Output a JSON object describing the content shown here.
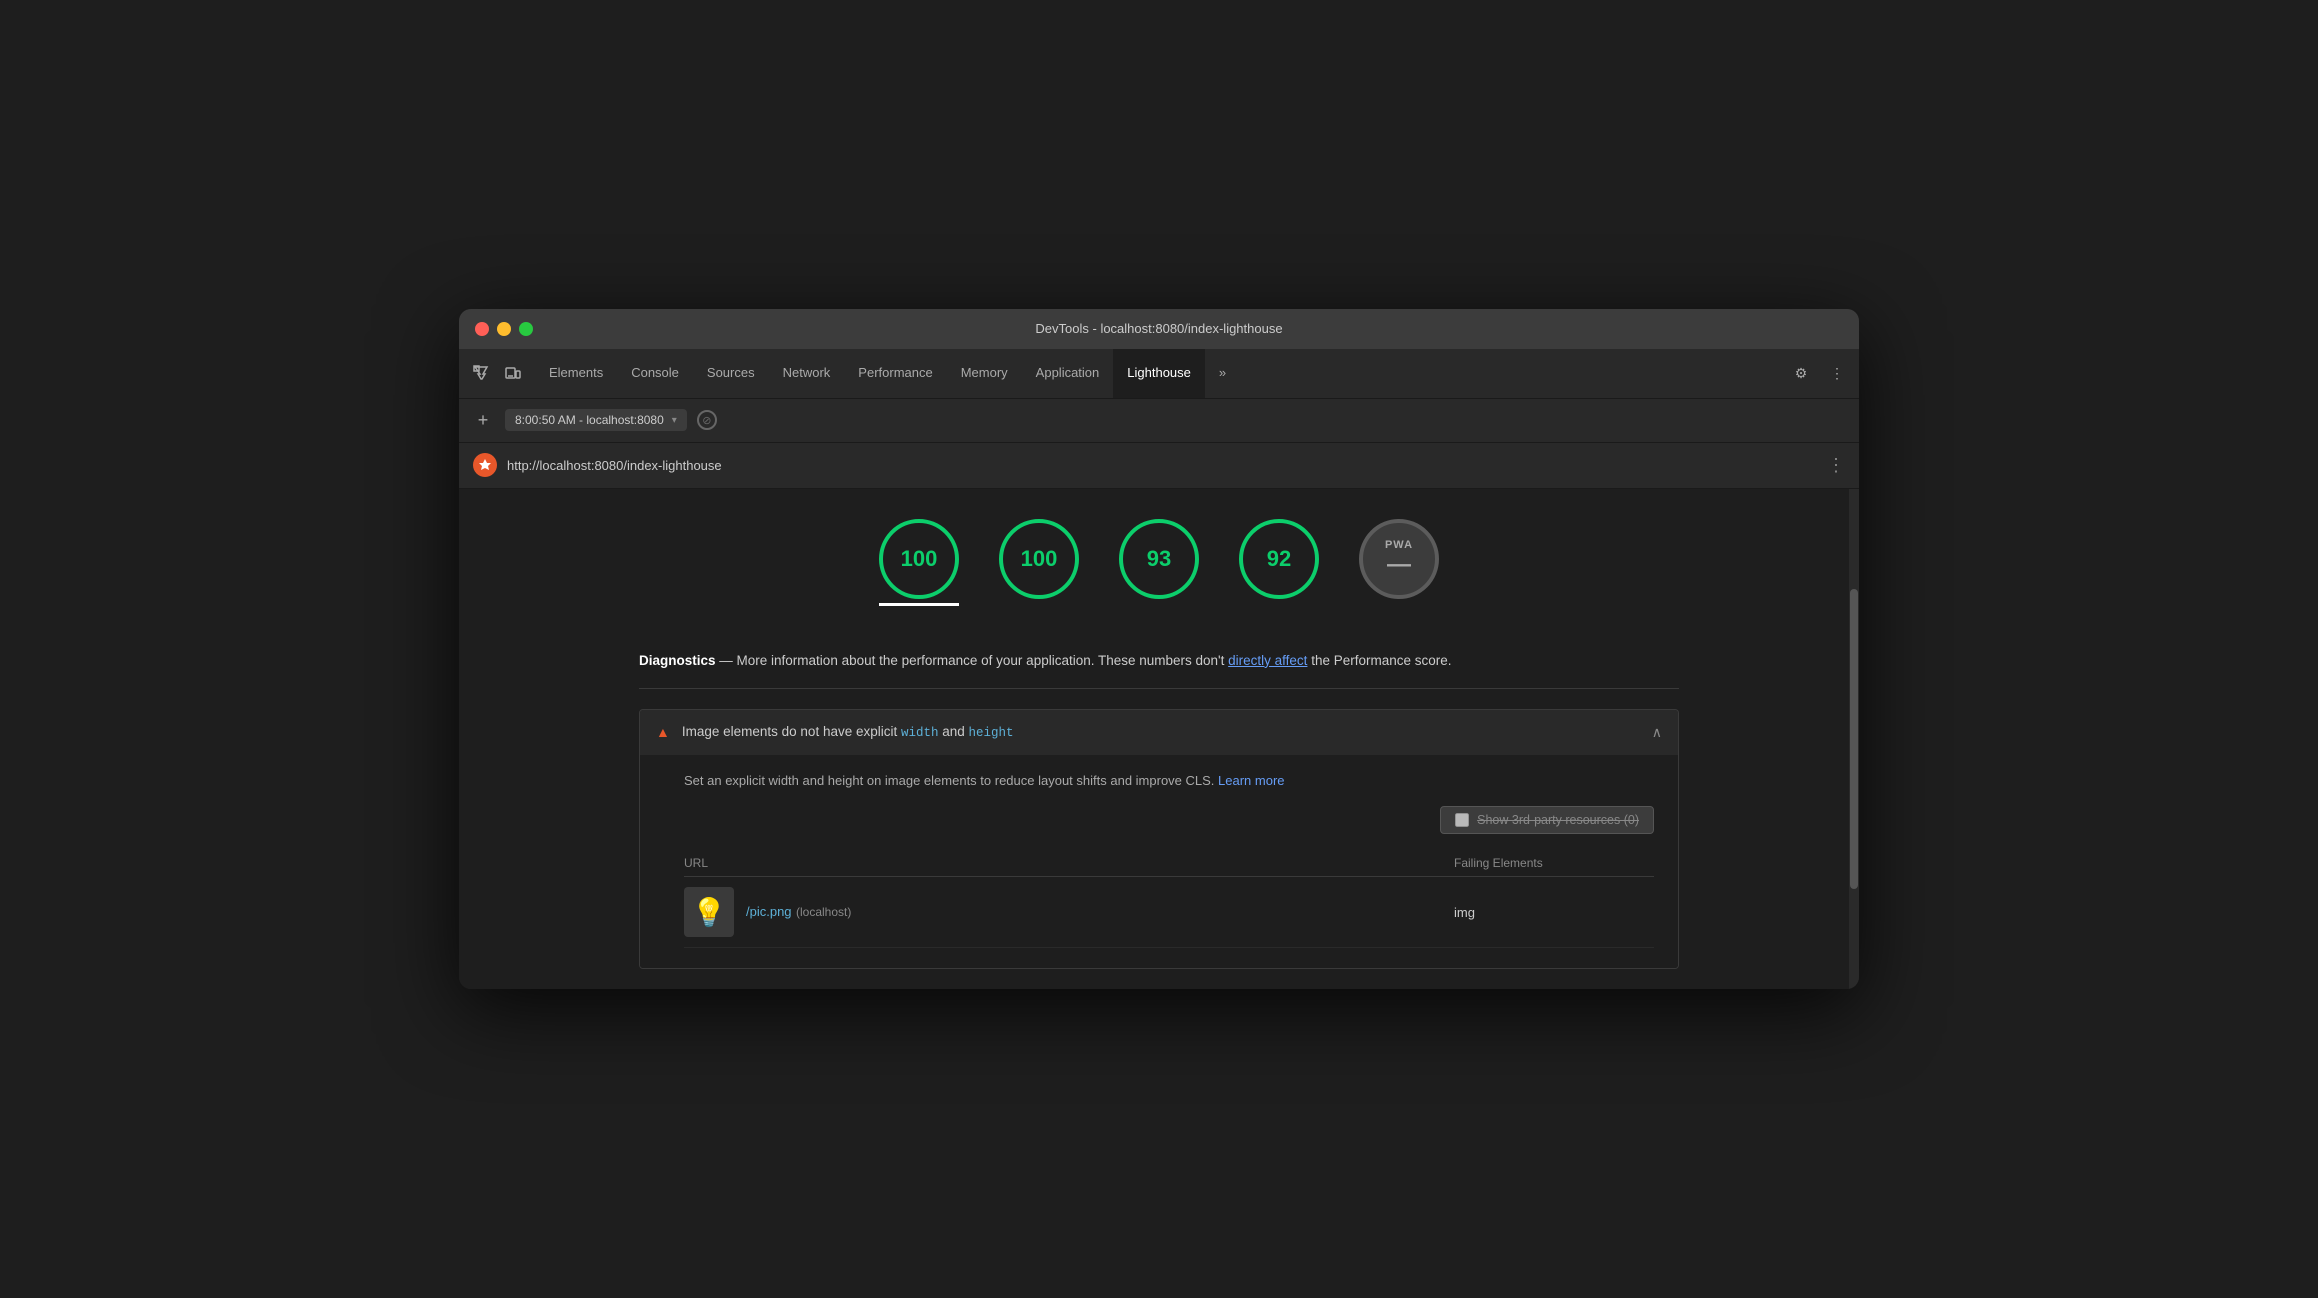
{
  "window": {
    "title": "DevTools - localhost:8080/index-lighthouse"
  },
  "traffic_lights": {
    "red": "red",
    "yellow": "yellow",
    "green": "green"
  },
  "tabs": [
    {
      "id": "elements",
      "label": "Elements",
      "active": false
    },
    {
      "id": "console",
      "label": "Console",
      "active": false
    },
    {
      "id": "sources",
      "label": "Sources",
      "active": false
    },
    {
      "id": "network",
      "label": "Network",
      "active": false
    },
    {
      "id": "performance",
      "label": "Performance",
      "active": false
    },
    {
      "id": "memory",
      "label": "Memory",
      "active": false
    },
    {
      "id": "application",
      "label": "Application",
      "active": false
    },
    {
      "id": "lighthouse",
      "label": "Lighthouse",
      "active": true
    }
  ],
  "more_tabs_label": "»",
  "toolbar": {
    "settings_icon": "⚙",
    "more_icon": "⋮"
  },
  "address_bar": {
    "plus": "+",
    "url": "8:00:50 AM - localhost:8080",
    "arrow": "▾",
    "stop_icon": "⊘"
  },
  "lh_header": {
    "url": "http://localhost:8080/index-lighthouse",
    "more_icon": "⋮"
  },
  "scores": [
    {
      "value": "100",
      "type": "green",
      "underline": true
    },
    {
      "value": "100",
      "type": "green",
      "underline": false
    },
    {
      "value": "93",
      "type": "green",
      "underline": false
    },
    {
      "value": "92",
      "type": "green",
      "underline": false
    },
    {
      "value": "PWA",
      "type": "pwa",
      "dash": "—",
      "underline": false
    }
  ],
  "diagnostics": {
    "title": "Diagnostics",
    "description": " — More information about the performance of your application. These numbers don't ",
    "link_text": "directly affect",
    "description_end": " the Performance score."
  },
  "audit": {
    "warning_icon": "▲",
    "title_start": "Image elements do not have explicit ",
    "code_width": "width",
    "title_and": " and ",
    "code_height": "height",
    "chevron_icon": "∧",
    "body_description": "Set an explicit width and height on image elements to reduce layout shifts and improve CLS. ",
    "learn_more": "Learn more",
    "third_party": {
      "checkbox_label": "Show 3rd-party resources (0)"
    },
    "table": {
      "col_url": "URL",
      "col_failing": "Failing Elements"
    },
    "rows": [
      {
        "thumbnail": "💡",
        "url": "/pic.png",
        "host": "(localhost)",
        "failing": "img"
      }
    ]
  }
}
